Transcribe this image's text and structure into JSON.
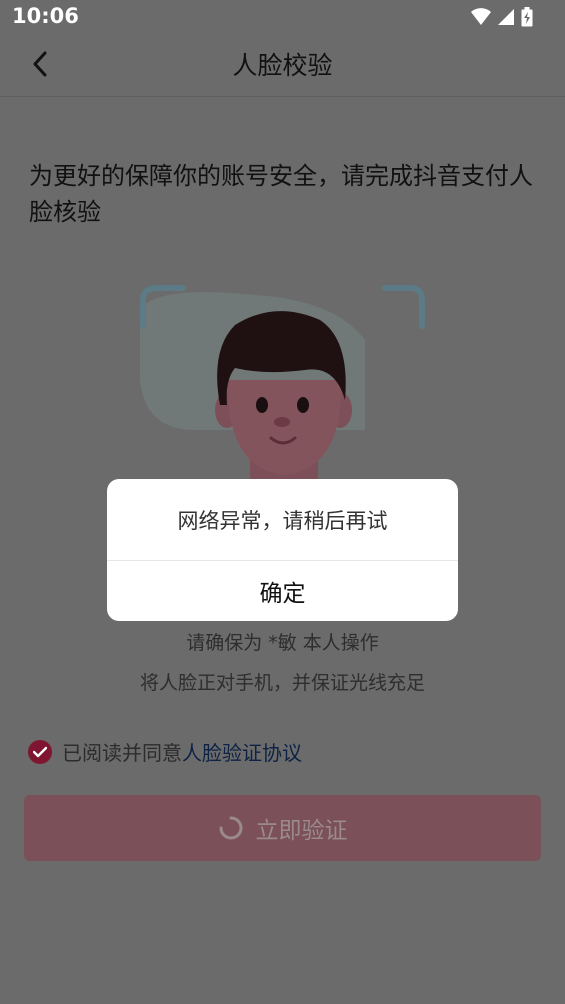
{
  "status_bar": {
    "time": "10:06"
  },
  "header": {
    "title": "人脸校验"
  },
  "instruction": "为更好的保障你的账号安全，请完成抖音支付人脸核验",
  "hints": {
    "line1": "请确保为 *敏 本人操作",
    "line2": "将人脸正对手机，并保证光线充足"
  },
  "agreement": {
    "checked": true,
    "prefix": "已阅读并同意",
    "link": "人脸验证协议"
  },
  "verify_button": {
    "label": "立即验证",
    "loading": true
  },
  "dialog": {
    "message": "网络异常，请稍后再试",
    "confirm_label": "确定"
  },
  "colors": {
    "overlay": "#6b6b6b",
    "accent": "#7f1530",
    "link": "#0e2245",
    "dialog_bg": "#ffffff"
  },
  "icons": [
    "wifi-icon",
    "signal-icon",
    "battery-icon",
    "back-arrow-icon",
    "checkmark-icon",
    "loading-spinner-icon",
    "face-illustration"
  ]
}
